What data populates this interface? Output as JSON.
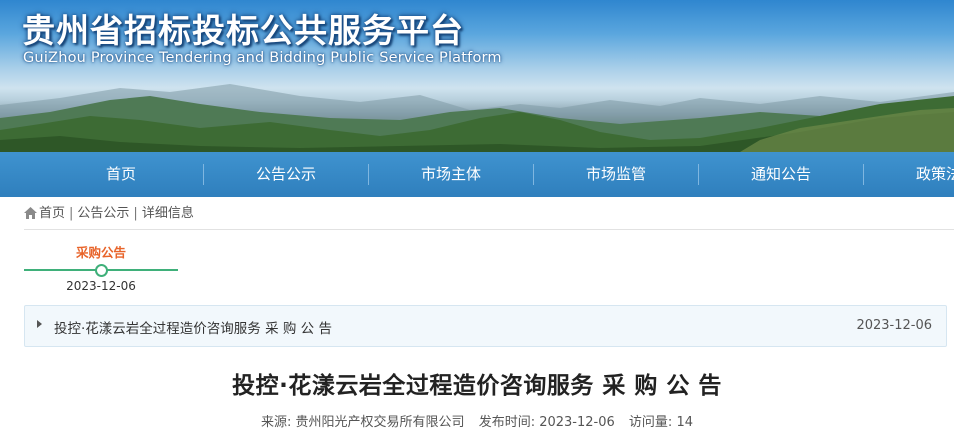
{
  "header": {
    "title": "贵州省招标投标公共服务平台",
    "subtitle": "GuiZhou Province Tendering and Bidding Public Service Platform"
  },
  "nav": {
    "items": [
      {
        "label": "首页"
      },
      {
        "label": "公告公示"
      },
      {
        "label": "市场主体"
      },
      {
        "label": "市场监管"
      },
      {
        "label": "通知公告"
      },
      {
        "label": "政策法"
      }
    ]
  },
  "breadcrumb": {
    "home": "首页",
    "level1": "公告公示",
    "level2": "详细信息",
    "separator": "|"
  },
  "timeline": {
    "label": "采购公告",
    "date": "2023-12-06"
  },
  "notice": {
    "title": "投控·花漾云岩全过程造价咨询服务 采 购 公 告",
    "date": "2023-12-06"
  },
  "article": {
    "title": "投控·花漾云岩全过程造价咨询服务 采 购 公 告",
    "source_label": "来源:",
    "source_value": "贵州阳光产权交易所有限公司",
    "publish_label": "发布时间:",
    "publish_value": "2023-12-06",
    "views_label": "访问量:",
    "views_value": "14"
  },
  "colors": {
    "nav_bg": "#2f7fbd",
    "accent_orange": "#e8642a",
    "timeline_green": "#3fb07a"
  }
}
